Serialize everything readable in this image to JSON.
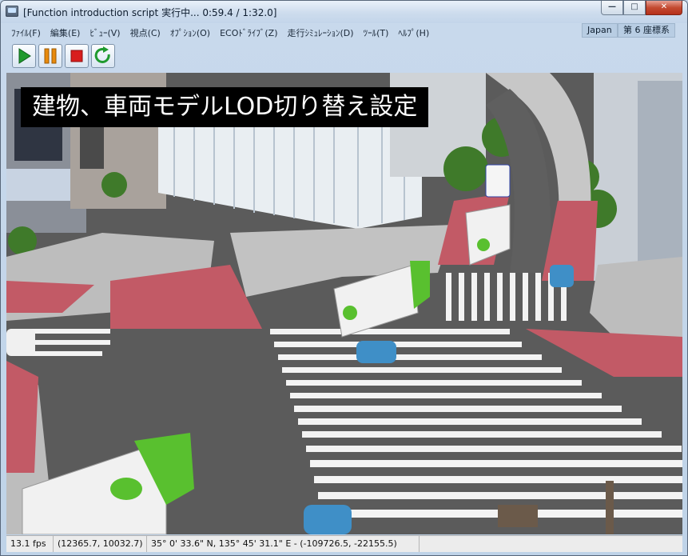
{
  "window": {
    "title": "[Function introduction script 実行中... 0:59.4 / 1:32.0]",
    "controls": {
      "minimize": "—",
      "maximize": "□",
      "close": "✕"
    }
  },
  "menu": {
    "items": [
      {
        "label": "ﾌｧｲﾙ(F)"
      },
      {
        "label": "編集(E)"
      },
      {
        "label": "ﾋﾞｭｰ(V)"
      },
      {
        "label": "視点(C)"
      },
      {
        "label": "ｵﾌﾟｼｮﾝ(O)"
      },
      {
        "label": "ECOﾄﾞﾗｲﾌﾞ(Z)"
      },
      {
        "label": "走行ｼﾐｭﾚｰｼｮﾝ(D)"
      },
      {
        "label": "ﾂｰﾙ(T)"
      },
      {
        "label": "ﾍﾙﾌﾟ(H)"
      }
    ],
    "region": "Japan",
    "coord_system": "第 6 座標系"
  },
  "toolbar": {
    "buttons": [
      {
        "icon": "play-icon",
        "color": "#1f9a2e"
      },
      {
        "icon": "pause-icon",
        "color": "#e88a0c"
      },
      {
        "icon": "stop-icon",
        "color": "#d81d1d"
      },
      {
        "icon": "loop-icon",
        "color": "#1f9a2e"
      }
    ]
  },
  "viewport": {
    "caption": "建物、車両モデルLOD切り替え設定",
    "colors": {
      "road": "#5b5b5b",
      "sidewalk": "#bdbdbd",
      "red_zone": "#c25a66",
      "crosswalk": "#f3f3f3",
      "truck_cab": "#59c02f"
    }
  },
  "status": {
    "fps": "13.1 fps",
    "xy": "(12365.7, 10032.7)",
    "location": "35°  0' 33.6\" N, 135°  45' 31.1\" E  -  (-109726.5, -22155.5)"
  }
}
